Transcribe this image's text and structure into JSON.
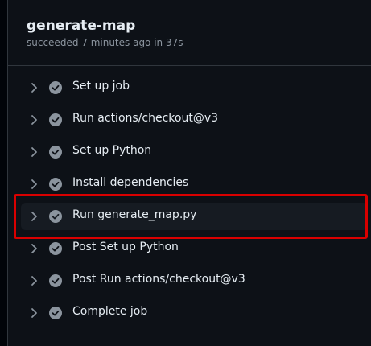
{
  "job": {
    "title": "generate-map",
    "status": "succeeded 7 minutes ago in 37s"
  },
  "colors": {
    "success_check": "#8b949e",
    "highlight": "#d90000"
  },
  "steps": [
    {
      "label": "Set up job",
      "icon": "check-circle-icon",
      "active": false
    },
    {
      "label": "Run actions/checkout@v3",
      "icon": "check-circle-icon",
      "active": false
    },
    {
      "label": "Set up Python",
      "icon": "check-circle-icon",
      "active": false
    },
    {
      "label": "Install dependencies",
      "icon": "check-circle-icon",
      "active": false
    },
    {
      "label": "Run generate_map.py",
      "icon": "check-circle-icon",
      "active": true
    },
    {
      "label": "Post Set up Python",
      "icon": "check-circle-icon",
      "active": false
    },
    {
      "label": "Post Run actions/checkout@v3",
      "icon": "check-circle-icon",
      "active": false
    },
    {
      "label": "Complete job",
      "icon": "check-circle-icon",
      "active": false
    }
  ]
}
